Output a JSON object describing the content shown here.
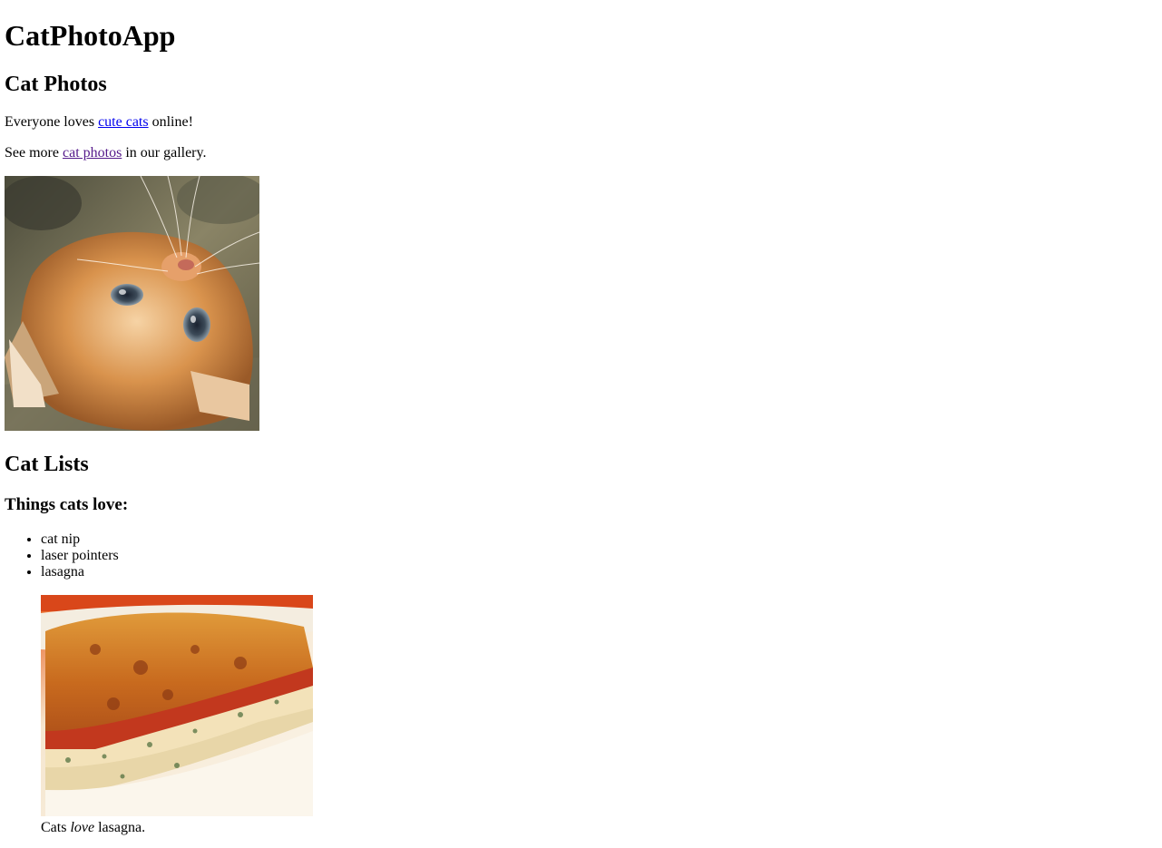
{
  "page": {
    "title": "CatPhotoApp"
  },
  "cat_photos_section": {
    "heading": "Cat Photos",
    "intro_prefix": "Everyone loves ",
    "intro_link": "cute cats",
    "intro_suffix": " online!",
    "gallery_prefix": "See more ",
    "gallery_link": "cat photos",
    "gallery_suffix": " in our gallery.",
    "image_alt": "A cute orange cat lying on its back."
  },
  "cat_lists_section": {
    "heading": "Cat Lists",
    "subheading": "Things cats love:",
    "items": [
      "cat nip",
      "laser pointers",
      "lasagna"
    ],
    "figure": {
      "image_alt": "A slice of lasagna on a plate.",
      "caption_prefix": "Cats ",
      "caption_emphasis": "love",
      "caption_suffix": " lasagna."
    }
  },
  "colors": {
    "link_unvisited": "#0000ee",
    "link_visited": "#551a8b"
  }
}
